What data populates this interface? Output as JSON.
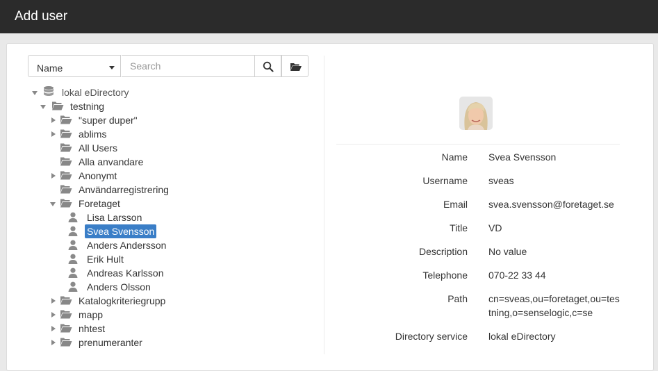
{
  "window": {
    "title": "Add user"
  },
  "toolbar": {
    "field_select": "Name",
    "search_placeholder": "Search"
  },
  "tree": {
    "root": "lokal eDirectory",
    "testning": "testning",
    "items": [
      "\"super duper\"",
      "ablims",
      "All Users",
      "Alla anvandare",
      "Anonymt",
      "Användarregistrering",
      "Foretaget",
      "Katalogkriteriegrupp",
      "mapp",
      "nhtest",
      "prenumeranter"
    ],
    "users": [
      "Lisa Larsson",
      "Svea Svensson",
      "Anders Andersson",
      "Erik Hult",
      "Andreas Karlsson",
      "Anders Olsson"
    ]
  },
  "details": {
    "labels": {
      "name": "Name",
      "username": "Username",
      "email": "Email",
      "title": "Title",
      "description": "Description",
      "telephone": "Telephone",
      "path": "Path",
      "directory_service": "Directory service"
    },
    "values": {
      "name": "Svea Svensson",
      "username": "sveas",
      "email": "svea.svensson@foretaget.se",
      "title": "VD",
      "description": "No value",
      "telephone": "070-22 33 44",
      "path_line1": "cn=sveas,ou=foretaget,ou=tes",
      "path_line2": "tning,o=senselogic,c=se",
      "directory_service": "lokal eDirectory"
    }
  }
}
